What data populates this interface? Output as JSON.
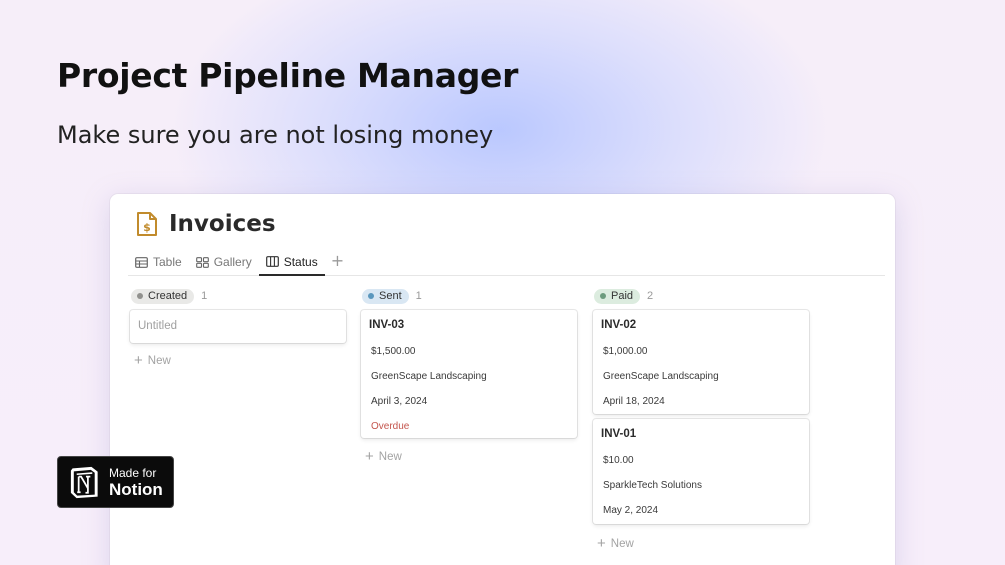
{
  "hero": {
    "title": "Project Pipeline Manager",
    "subtitle": "Make sure you are not losing money"
  },
  "badge": {
    "small": "Made for",
    "big": "Notion",
    "icon": "notion-logo"
  },
  "database": {
    "title": "Invoices",
    "icon": "invoice-dollar-icon",
    "tabs": [
      {
        "label": "Table",
        "icon": "table-icon"
      },
      {
        "label": "Gallery",
        "icon": "gallery-icon"
      },
      {
        "label": "Status",
        "icon": "board-icon",
        "active": true
      }
    ],
    "add_view_label": "+"
  },
  "columns": [
    {
      "status": "Created",
      "count": "1",
      "pill_color": "#e9e9e7",
      "dot_color": "#91918e",
      "cards": [
        {
          "title": "Untitled",
          "placeholder": true
        }
      ],
      "new_label": "New"
    },
    {
      "status": "Sent",
      "count": "1",
      "pill_color": "#d9e7f3",
      "dot_color": "#5b97bd",
      "cards": [
        {
          "title": "INV-03",
          "amount": "$1,500.00",
          "client": "GreenScape Landscaping",
          "date": "April 3, 2024",
          "flag": "Overdue"
        }
      ],
      "new_label": "New"
    },
    {
      "status": "Paid",
      "count": "2",
      "pill_color": "#dcecdf",
      "dot_color": "#6c9b7d",
      "cards": [
        {
          "title": "INV-02",
          "amount": "$1,000.00",
          "client": "GreenScape Landscaping",
          "date": "April 18, 2024"
        },
        {
          "title": "INV-01",
          "amount": "$10.00",
          "client": "SparkleTech Solutions",
          "date": "May 2, 2024"
        }
      ],
      "new_label": "New"
    }
  ],
  "colors": {
    "overdue": "#c4554d",
    "accent_glow": "#b7c6ff",
    "icon_gold": "#c18b2c"
  }
}
